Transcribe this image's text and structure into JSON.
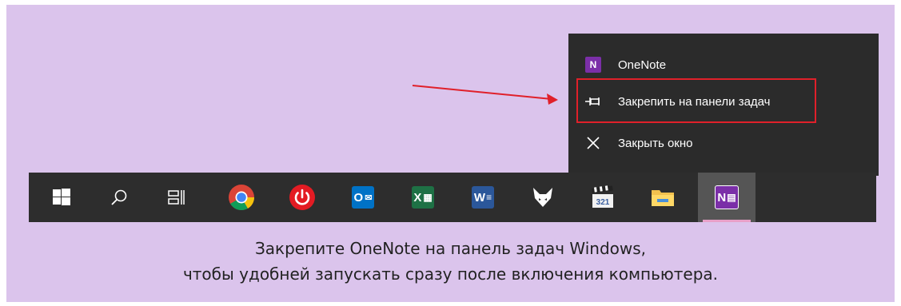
{
  "context_menu": {
    "items": [
      {
        "label": "OneNote",
        "icon": "onenote-icon"
      },
      {
        "label": "Закрепить на панели задач",
        "icon": "pin-icon"
      },
      {
        "label": "Закрыть окно",
        "icon": "close-icon"
      }
    ],
    "highlighted_item": "Закрепить на панели задач",
    "highlight_color": "#e0202a"
  },
  "taskbar": {
    "items": [
      {
        "name": "start",
        "icon": "windows-logo-icon"
      },
      {
        "name": "search",
        "icon": "search-icon"
      },
      {
        "name": "task-view",
        "icon": "task-view-icon"
      },
      {
        "name": "chrome",
        "icon": "chrome-icon"
      },
      {
        "name": "power",
        "icon": "power-icon"
      },
      {
        "name": "outlook",
        "icon": "outlook-icon",
        "letter": "O"
      },
      {
        "name": "excel",
        "icon": "excel-icon",
        "letter": "X"
      },
      {
        "name": "word",
        "icon": "word-icon",
        "letter": "W"
      },
      {
        "name": "fox-app",
        "icon": "fox-icon"
      },
      {
        "name": "media-player",
        "icon": "clapperboard-321-icon",
        "text": "321"
      },
      {
        "name": "file-explorer",
        "icon": "folder-icon"
      },
      {
        "name": "onenote",
        "icon": "onenote-icon",
        "letter": "N",
        "active": true
      }
    ]
  },
  "caption": {
    "line1": "Закрепите OneNote на панель задач Windows,",
    "line2": "чтобы удобней запускать сразу после включения компьютера."
  },
  "colors": {
    "background": "#dbc4ec",
    "taskbar": "#2d2d2d",
    "menu": "#2b2b2b",
    "arrow": "#e0202a",
    "onenote": "#7b2fa8"
  }
}
